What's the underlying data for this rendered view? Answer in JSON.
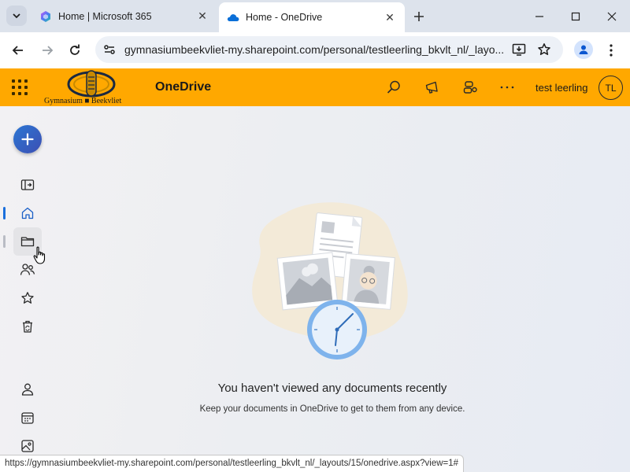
{
  "browser": {
    "tabs": [
      {
        "title": "Home | Microsoft 365",
        "active": false,
        "favicon": "microsoft365-icon"
      },
      {
        "title": "Home - OneDrive",
        "active": true,
        "favicon": "onedrive-cloud-icon"
      }
    ],
    "url": "gymnasiumbeekvliet-my.sharepoint.com/personal/testleerling_bkvlt_nl/_layo...",
    "status_url": "https://gymnasiumbeekvliet-my.sharepoint.com/personal/testleerling_bkvlt_nl/_layouts/15/onedrive.aspx?view=1#"
  },
  "header": {
    "logo_text": "Gymnasium ■ Beekvliet",
    "app_name": "OneDrive",
    "user_name": "test leerling",
    "user_initials": "TL",
    "brand_color": "#ffa800"
  },
  "rail": {
    "items": [
      {
        "name": "view-toggle",
        "icon": "panel-toggle-icon"
      },
      {
        "name": "home",
        "icon": "home-icon",
        "selected": true
      },
      {
        "name": "my-files",
        "icon": "folder-icon",
        "hovered": true
      },
      {
        "name": "shared",
        "icon": "people-icon"
      },
      {
        "name": "favorites",
        "icon": "star-icon"
      },
      {
        "name": "recycle-bin",
        "icon": "recycle-bin-icon"
      },
      {
        "name": "people",
        "icon": "person-icon"
      },
      {
        "name": "meetings",
        "icon": "calendar-icon"
      },
      {
        "name": "media",
        "icon": "image-icon"
      }
    ]
  },
  "empty_state": {
    "title": "You haven't viewed any documents recently",
    "subtitle": "Keep your documents in OneDrive to get to them from any device."
  }
}
